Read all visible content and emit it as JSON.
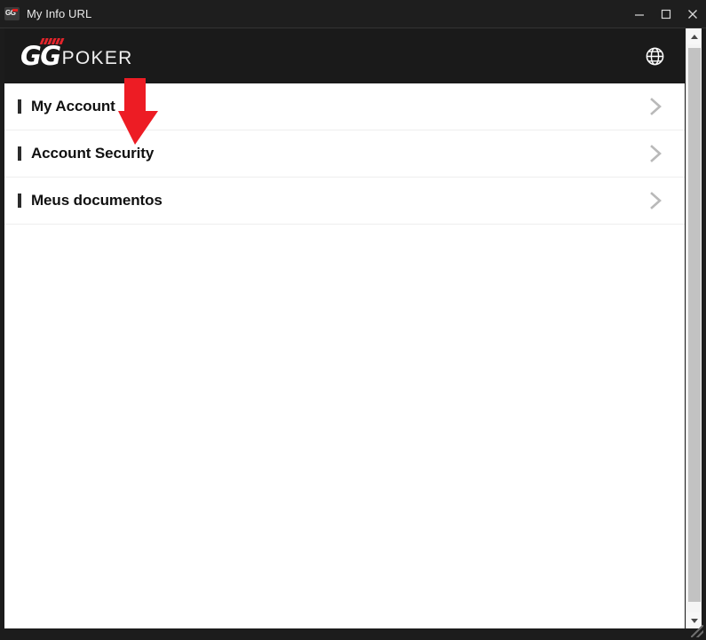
{
  "window": {
    "title": "My Info URL",
    "app_icon": "gg-app-icon",
    "controls": [
      {
        "name": "minimize-button",
        "icon": "minimize-icon"
      },
      {
        "name": "maximize-button",
        "icon": "maximize-icon"
      },
      {
        "name": "close-button",
        "icon": "close-icon"
      }
    ]
  },
  "brand": {
    "mark": "GG",
    "word": "POKER",
    "language_icon": "globe-icon",
    "header_bg": "#1a1a1a",
    "accent": "#e3242b"
  },
  "menu": {
    "items": [
      {
        "label": "My Account",
        "chevron": "chevron-right-icon"
      },
      {
        "label": "Account Security",
        "chevron": "chevron-right-icon"
      },
      {
        "label": "Meus documentos",
        "chevron": "chevron-right-icon"
      }
    ]
  },
  "annotation": {
    "type": "down-arrow",
    "color": "#ed1c24",
    "points_at": "Account Security"
  },
  "scrollbar": {
    "up_icon": "scroll-up-arrow-icon",
    "down_icon": "scroll-down-arrow-icon",
    "thumb": "scrollbar-thumb"
  }
}
